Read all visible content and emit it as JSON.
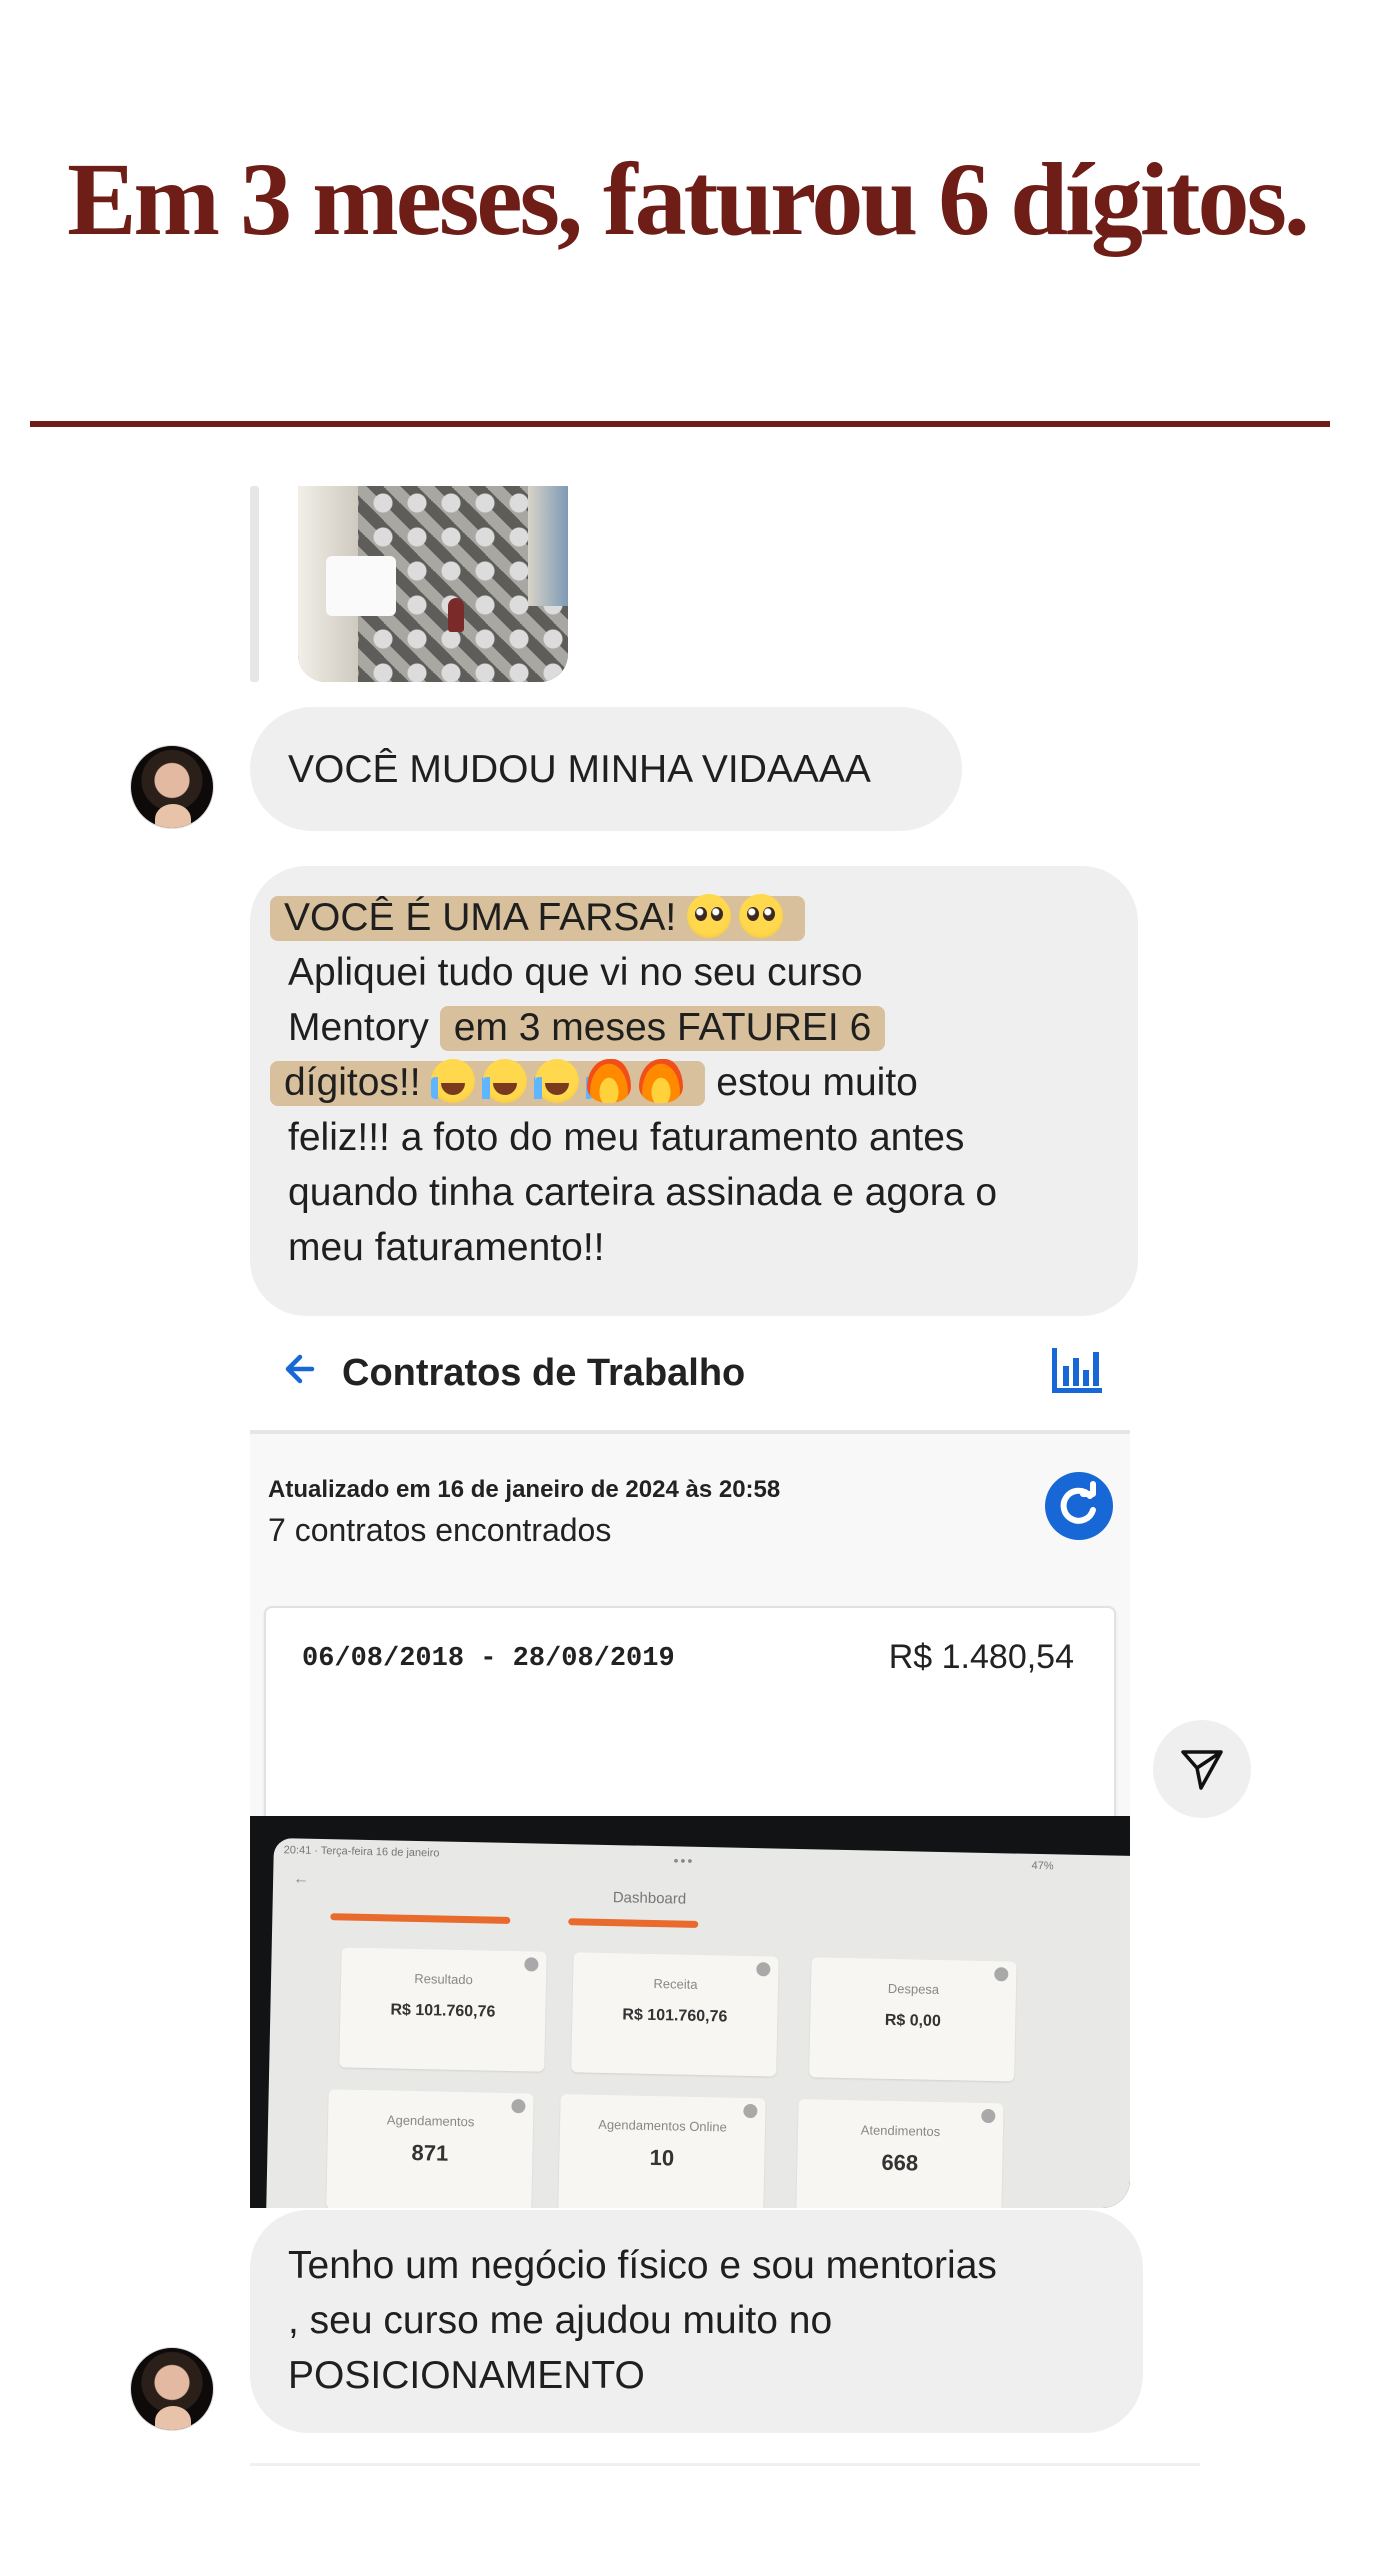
{
  "headline": "Em 3 meses, faturou 6 dígitos.",
  "messages": {
    "first": "VOCÊ MUDOU MINHA VIDAAAA",
    "second": {
      "highlight1": "VOCÊ É UMA FARSA!",
      "line2": "Apliquei tudo que vi no seu curso",
      "line3_start": "Mentory",
      "highlight2": "em 3 meses FATUREI 6",
      "highlight3": "dígitos!!",
      "line4_end": "estou muito",
      "line5": "feliz!!! a foto do meu faturamento antes",
      "line6": "quando tinha carteira assinada e agora o",
      "line7": "meu faturamento!!"
    },
    "third": {
      "line1": "Tenho um negócio físico e sou mentorias",
      "line2": ", seu curso me ajudou muito no",
      "line3": "POSICIONAMENTO"
    }
  },
  "contracts_screenshot": {
    "title": "Contratos de Trabalho",
    "updated": "Atualizado em 16 de janeiro de 2024 às 20:58",
    "count": "7 contratos encontrados",
    "period": "06/08/2018 - 28/08/2019",
    "amount": "R$ 1.480,54",
    "accent_color": "#1768d6"
  },
  "dashboard_photo": {
    "status_left": "20:41 · Terça-feira 16 de janeiro",
    "status_right": "47%",
    "title": "Dashboard",
    "cards": [
      {
        "label": "Resultado",
        "value": "R$ 101.760,76"
      },
      {
        "label": "Receita",
        "value": "R$ 101.760,76"
      },
      {
        "label": "Despesa",
        "value": "R$ 0,00"
      },
      {
        "label": "Agendamentos",
        "value": "871"
      },
      {
        "label": "Agendamentos Online",
        "value": "10"
      },
      {
        "label": "Atendimentos",
        "value": "668"
      }
    ]
  },
  "colors": {
    "headline": "#6e1d17",
    "bubble": "#efefef",
    "highlight": "#d7c09b"
  },
  "icons": [
    "back-arrow-icon",
    "bar-chart-icon",
    "refresh-icon",
    "send-icon",
    "pleading-face-icon",
    "crying-face-icon",
    "fire-icon"
  ]
}
